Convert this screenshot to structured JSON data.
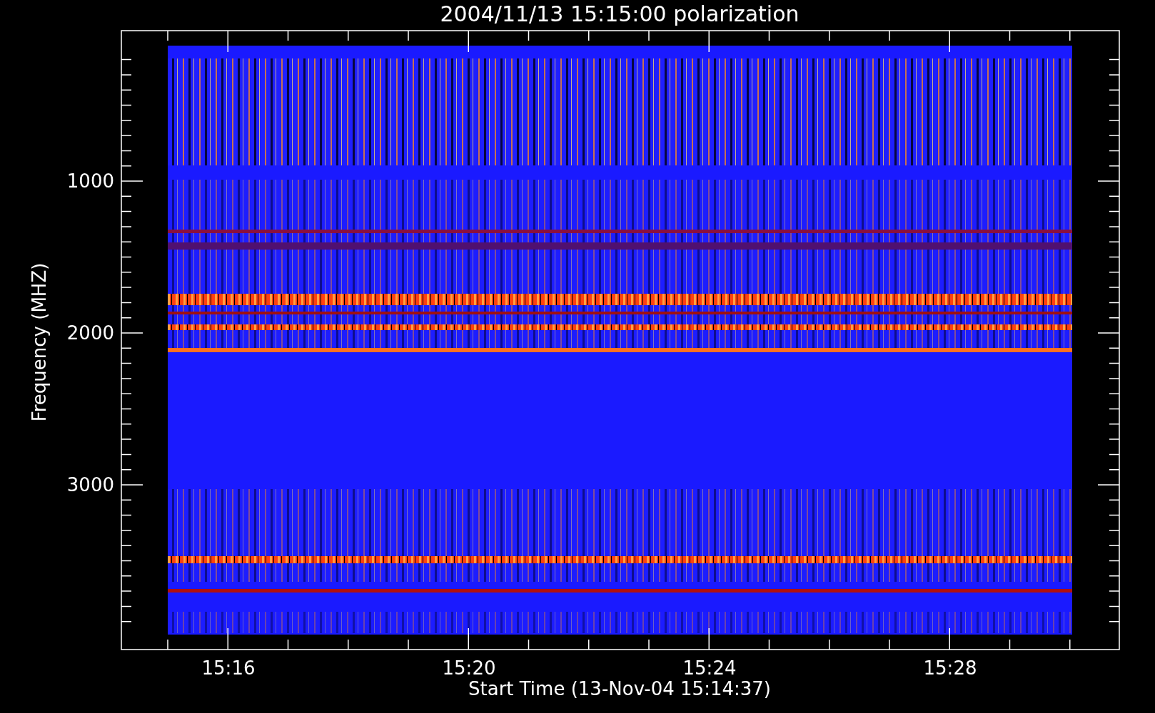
{
  "title": "2004/11/13 15:15:00 polarization",
  "y_axis": {
    "label": "Frequency (MHZ)",
    "ticks": [
      "1000",
      "2000",
      "3000"
    ]
  },
  "x_axis": {
    "label": "Start Time (13-Nov-04 15:14:37)",
    "ticks": [
      "15:16",
      "15:20",
      "15:24",
      "15:28"
    ]
  }
}
